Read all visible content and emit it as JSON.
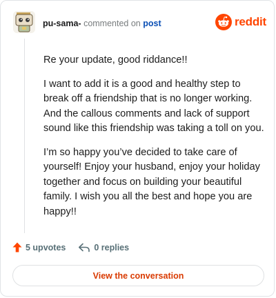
{
  "header": {
    "username": "pu-sama-",
    "action_text": "commented on",
    "post_link": "post",
    "brand": "reddit"
  },
  "comment": {
    "paragraphs": [
      "Re your update, good riddance!!",
      "I want to add it is a good and healthy step to break off a friendship that is no longer working. And the callous comments and lack of support sound like this friendship was taking a toll on you.",
      "I’m so happy you’ve decided to take care of yourself! Enjoy your husband, enjoy your holiday together and focus on building your beautiful family. I wish you all the best and hope you are happy!!"
    ]
  },
  "actions": {
    "upvotes_label": "5 upvotes",
    "replies_label": "0 replies"
  },
  "footer": {
    "view_conversation_label": "View the conversation"
  },
  "colors": {
    "brand": "#ff4500",
    "link": "#0a4fb5",
    "button_text": "#d93a00"
  },
  "icons": {
    "avatar": "snoo-avatar",
    "logo": "reddit-snoo-icon",
    "upvote": "upvote-arrow-icon",
    "reply": "reply-arrow-icon"
  }
}
